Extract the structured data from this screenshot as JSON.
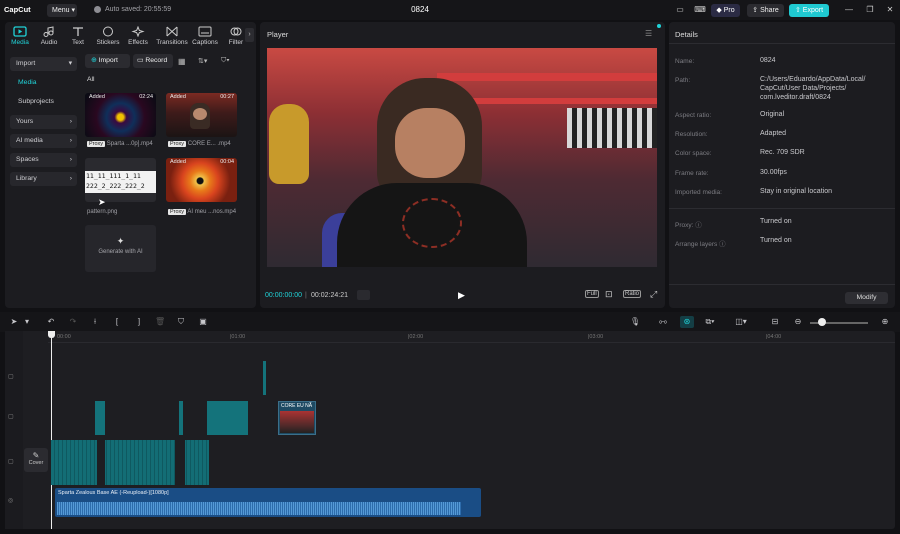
{
  "app": {
    "name": "CapCut",
    "menu_label": "Menu",
    "autosave": "Auto saved: 20:55:59",
    "project_title": "0824",
    "pro_label": "Pro",
    "share_label": "Share",
    "export_label": "Export"
  },
  "toolbar_tabs": [
    "Media",
    "Audio",
    "Text",
    "Stickers",
    "Effects",
    "Transitions",
    "Captions",
    "Filter"
  ],
  "sidebar": {
    "import": "Import",
    "media": "Media",
    "subprojects": "Subprojects",
    "yours": "Yours",
    "ai_media": "AI media",
    "spaces": "Spaces",
    "library": "Library"
  },
  "media": {
    "import_button": "Import",
    "record_button": "Record",
    "filter_all": "All",
    "items": [
      {
        "added": "Added",
        "duration": "02:24",
        "proxy": "Proxy",
        "name": "Sparta ...0p].mp4"
      },
      {
        "added": "Added",
        "duration": "00:27",
        "proxy": "Proxy",
        "name": "CORE E... .mp4"
      },
      {
        "thumb_text": "11_11_111_1_11\n222_2_222_222_2",
        "name": "pattern.png"
      },
      {
        "added": "Added",
        "duration": "00:04",
        "proxy": "Proxy",
        "name": "AI meu ...nos.mp4"
      }
    ],
    "generate_ai": "Generate with AI"
  },
  "player": {
    "title": "Player",
    "current_time": "00:00:00:00",
    "total_time": "00:02:24:21",
    "full_label": "Full",
    "ratio_label": "Ratio"
  },
  "details": {
    "title": "Details",
    "rows": [
      {
        "key": "Name:",
        "value": "0824"
      },
      {
        "key": "Path:",
        "value": "C:/Users/Eduardo/AppData/Local/\nCapCut/User Data/Projects/\ncom.lveditor.draft/0824"
      },
      {
        "key": "Aspect ratio:",
        "value": "Original"
      },
      {
        "key": "Resolution:",
        "value": "Adapted"
      },
      {
        "key": "Color space:",
        "value": "Rec. 709 SDR"
      },
      {
        "key": "Frame rate:",
        "value": "30.00fps"
      },
      {
        "key": "Imported media:",
        "value": "Stay in original location"
      },
      {
        "key": "Proxy:",
        "value": "Turned on"
      },
      {
        "key": "Arrange layers",
        "value": "Turned on"
      }
    ],
    "modify_button": "Modify"
  },
  "timeline": {
    "ruler": [
      "00:00",
      "|01:00",
      "|02:00",
      "|03:00",
      "|04:00"
    ],
    "clip_title": "CORE EU NÃ",
    "audio_clip": "Sparta Zealous Base AE (-Reupload-)[1080p]",
    "cover_label": "Cover"
  },
  "colors": {
    "accent": "#20d3d8",
    "export": "#1fc9d1",
    "video_clip": "#14737b",
    "audio_clip": "#1a4d85",
    "panel": "#1c1c20"
  }
}
